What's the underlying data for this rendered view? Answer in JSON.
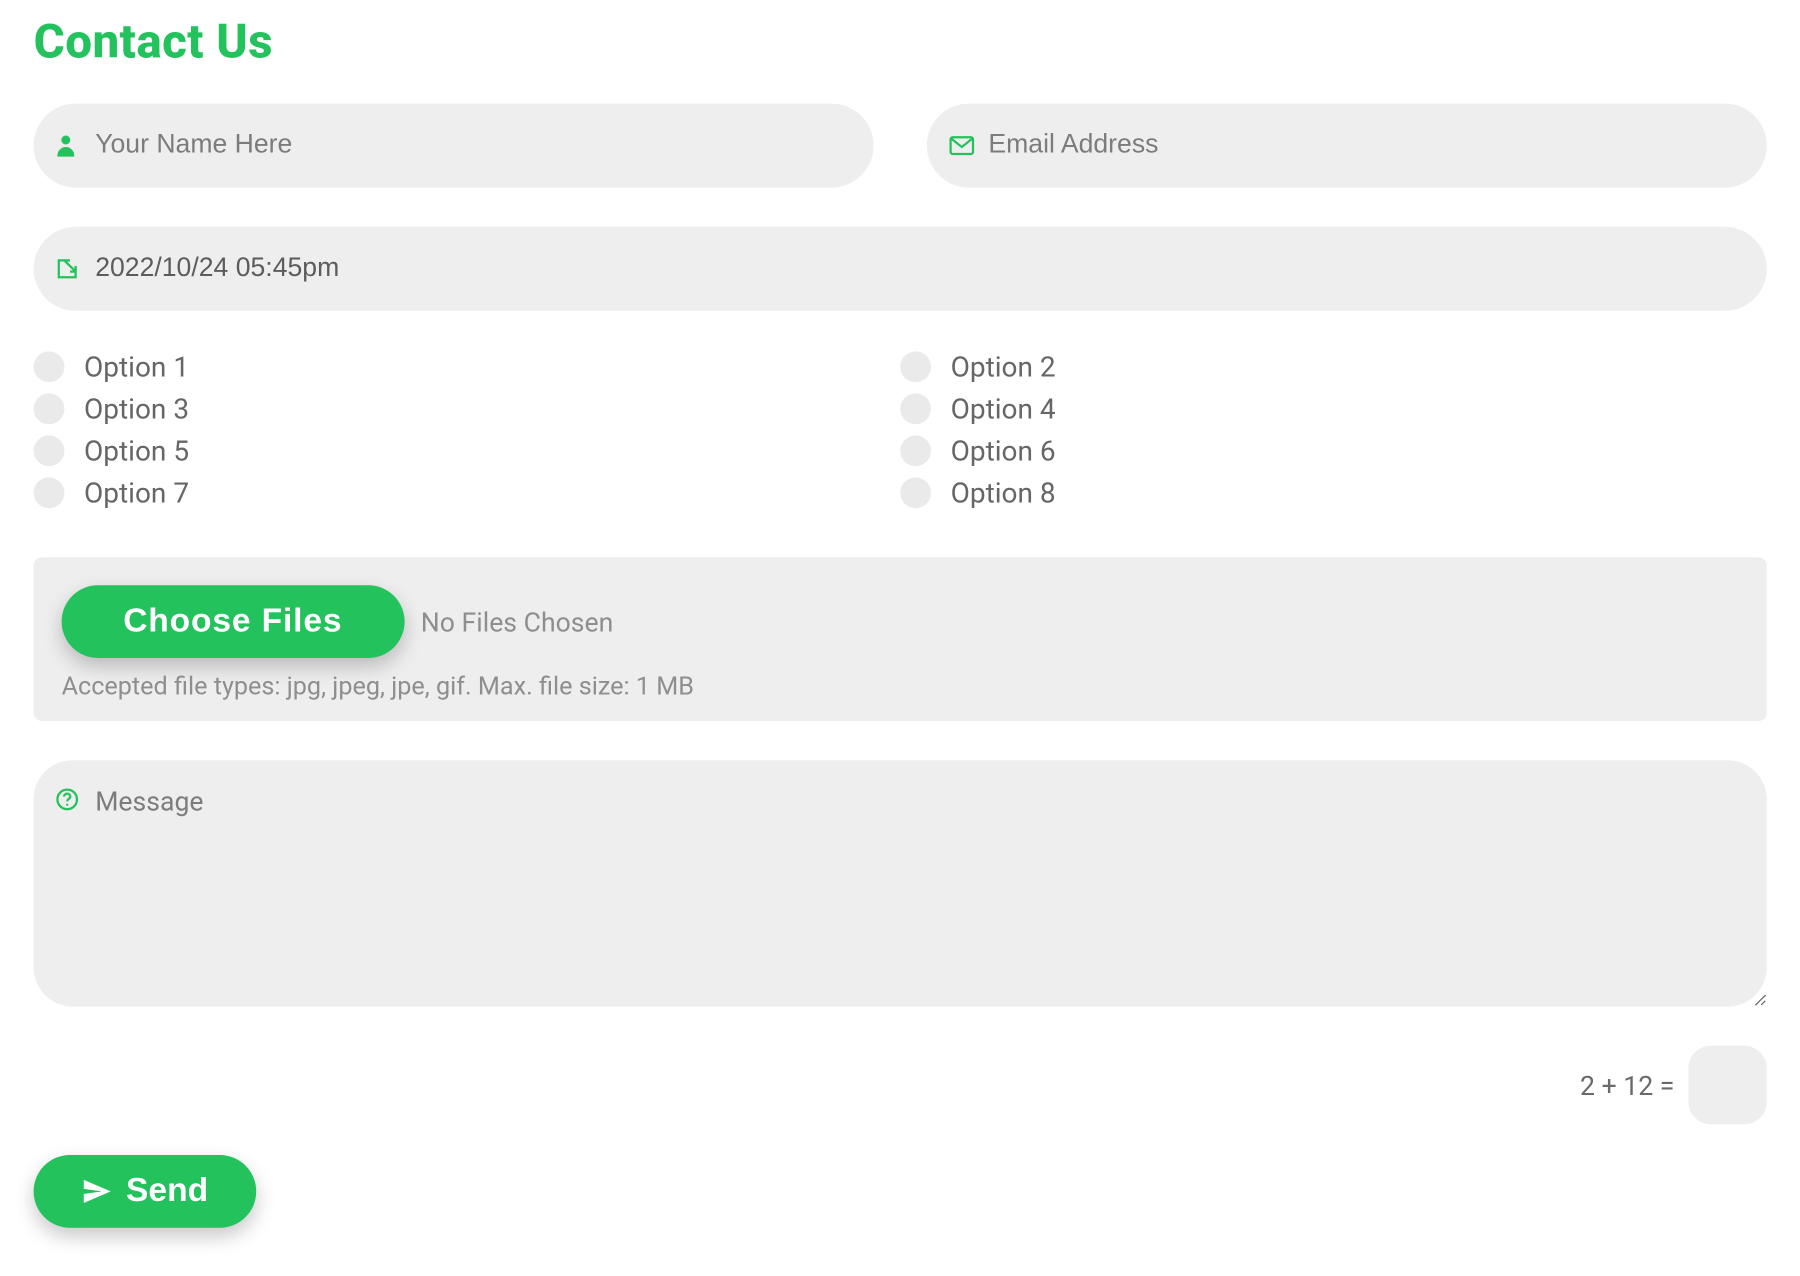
{
  "title": "Contact Us",
  "name": {
    "placeholder": "Your Name Here",
    "value": ""
  },
  "email": {
    "placeholder": "Email Address",
    "value": ""
  },
  "datetime": {
    "value": "2022/10/24 05:45pm"
  },
  "checkboxes": {
    "left": [
      "Option 1",
      "Option 3",
      "Option 5",
      "Option 7"
    ],
    "right": [
      "Option 2",
      "Option 4",
      "Option 6",
      "Option 8"
    ]
  },
  "file": {
    "button_label": "Choose Files",
    "status": "No Files Chosen",
    "hint": "Accepted file types: jpg, jpeg, jpe, gif. Max. file size: 1 MB"
  },
  "message": {
    "placeholder": "Message",
    "value": ""
  },
  "captcha": {
    "question": "2 + 12 =",
    "value": ""
  },
  "send_label": "Send"
}
